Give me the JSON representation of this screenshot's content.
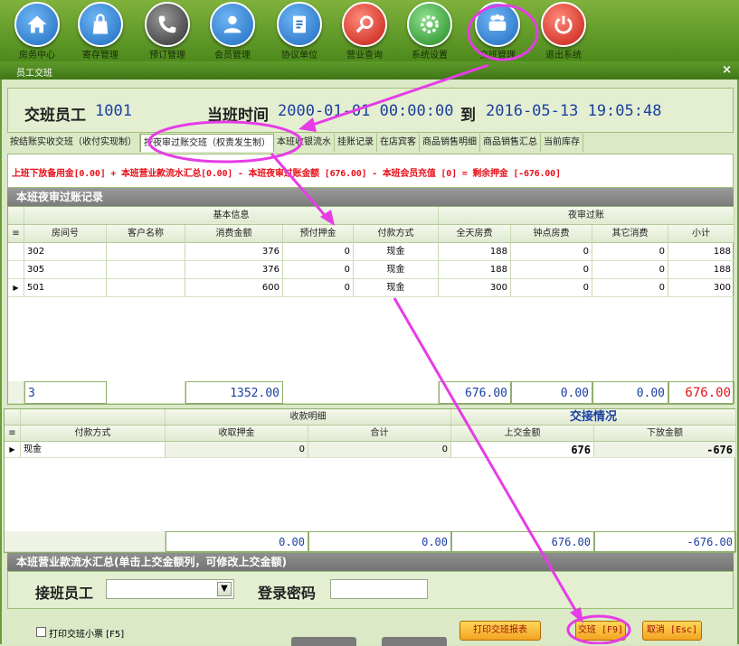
{
  "toolbar": {
    "items": [
      {
        "label": "房务中心",
        "icon": "home-icon",
        "color": "#2d82d4"
      },
      {
        "label": "寄存管理",
        "icon": "bag-icon",
        "color": "#2d82d4"
      },
      {
        "label": "预订管理",
        "icon": "phone-icon",
        "color": "#555"
      },
      {
        "label": "会员管理",
        "icon": "user-icon",
        "color": "#2d82d4"
      },
      {
        "label": "协议单位",
        "icon": "contract-icon",
        "color": "#2d82d4"
      },
      {
        "label": "营业查询",
        "icon": "search-icon",
        "color": "#e0322a"
      },
      {
        "label": "系统设置",
        "icon": "gear-icon",
        "color": "#2f9a2f"
      },
      {
        "label": "交班管理",
        "icon": "handover-icon",
        "color": "#2d82d4"
      },
      {
        "label": "退出系统",
        "icon": "power-icon",
        "color": "#e0322a"
      }
    ]
  },
  "window": {
    "title": "员工交班",
    "close": "×"
  },
  "shift": {
    "staff_label": "交班员工",
    "staff_value": "1001",
    "time_label": "当班时间",
    "time_start": "2000-01-01 00:00:00",
    "to_label": "到",
    "time_end": "2016-05-13 19:05:48"
  },
  "tabs": [
    "按结账实收交班（收付实现制）",
    "按夜审过账交班（权责发生制）",
    "本班收银流水",
    "挂账记录",
    "在店宾客",
    "商品销售明细",
    "商品销售汇总",
    "当前库存"
  ],
  "formula": "上班下放备用金[0.00] + 本班营业款流水汇总[0.00] - 本班夜审过账金额 [676.00] - 本班会员充值 [0]  = 剩余押金 [-676.00]",
  "night_audit": {
    "title": "本班夜审过账记录",
    "group_basic": "基本信息",
    "group_night": "夜审过账",
    "columns": [
      "房间号",
      "客户名称",
      "消费金额",
      "预付押金",
      "付款方式",
      "全天房费",
      "钟点房费",
      "其它消费",
      "小计"
    ],
    "rows": [
      {
        "room": "302",
        "customer": "",
        "amount": "376",
        "deposit": "0",
        "pay": "现金",
        "fullday": "188",
        "hourly": "0",
        "other": "0",
        "subtotal": "188"
      },
      {
        "room": "305",
        "customer": "",
        "amount": "376",
        "deposit": "0",
        "pay": "现金",
        "fullday": "188",
        "hourly": "0",
        "other": "0",
        "subtotal": "188"
      },
      {
        "room": "501",
        "customer": "",
        "amount": "600",
        "deposit": "0",
        "pay": "现金",
        "fullday": "300",
        "hourly": "0",
        "other": "0",
        "subtotal": "300"
      }
    ],
    "totals": {
      "count": "3",
      "amount": "1352.00",
      "fullday": "676.00",
      "hourly": "0.00",
      "other": "0.00",
      "subtotal": "676.00"
    }
  },
  "payment": {
    "group_detail": "收款明细",
    "group_handover": "交接情况",
    "columns": [
      "付款方式",
      "收取押金",
      "合计",
      "上交金额",
      "下放金额"
    ],
    "rows": [
      {
        "method": "现金",
        "deposit": "0",
        "total": "0",
        "handed": "676",
        "released": "-676"
      }
    ],
    "totals": {
      "deposit": "0.00",
      "total": "0.00",
      "handed": "676.00",
      "released": "-676.00"
    }
  },
  "footer": {
    "flow_title": "本班营业款流水汇总(单击上交金额列，可修改上交金额)",
    "receiver_label": "接班员工",
    "receiver_value": "",
    "password_label": "登录密码",
    "print_ticket": "打印交班小票 [F5]",
    "print_report": "打印交班报表",
    "handover_btn": "交班 [F9]",
    "cancel_btn": "取消 [Esc]"
  },
  "annotation_color": "#e63ce6"
}
